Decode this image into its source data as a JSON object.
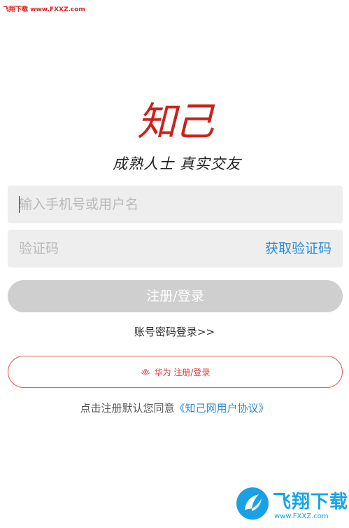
{
  "watermark": {
    "top_text": "飞翔下载 www.FXXZ.com",
    "bottom_text": "飞翔下载",
    "bottom_url": "www.FXXZ.com"
  },
  "brand": {
    "logo_text": "知己",
    "slogan": "成熟人士 真实交友",
    "color": "#c8231b"
  },
  "form": {
    "phone_placeholder": "输入手机号或用户名",
    "phone_value": "",
    "code_placeholder": "验证码",
    "code_value": "",
    "get_code_label": "获取验证码",
    "submit_label": "注册/登录",
    "account_login_label": "账号密码登录>>"
  },
  "huawei": {
    "icon": "huawei-logo-icon",
    "label": "华为 注册/登录"
  },
  "agreement": {
    "prefix": "点击注册默认您同意",
    "link": "《知己网用户协议》"
  },
  "colors": {
    "accent_blue": "#2a8ad8",
    "brand_red": "#c8231b",
    "button_disabled": "#cfcfcf",
    "input_bg": "#eeeeee"
  }
}
